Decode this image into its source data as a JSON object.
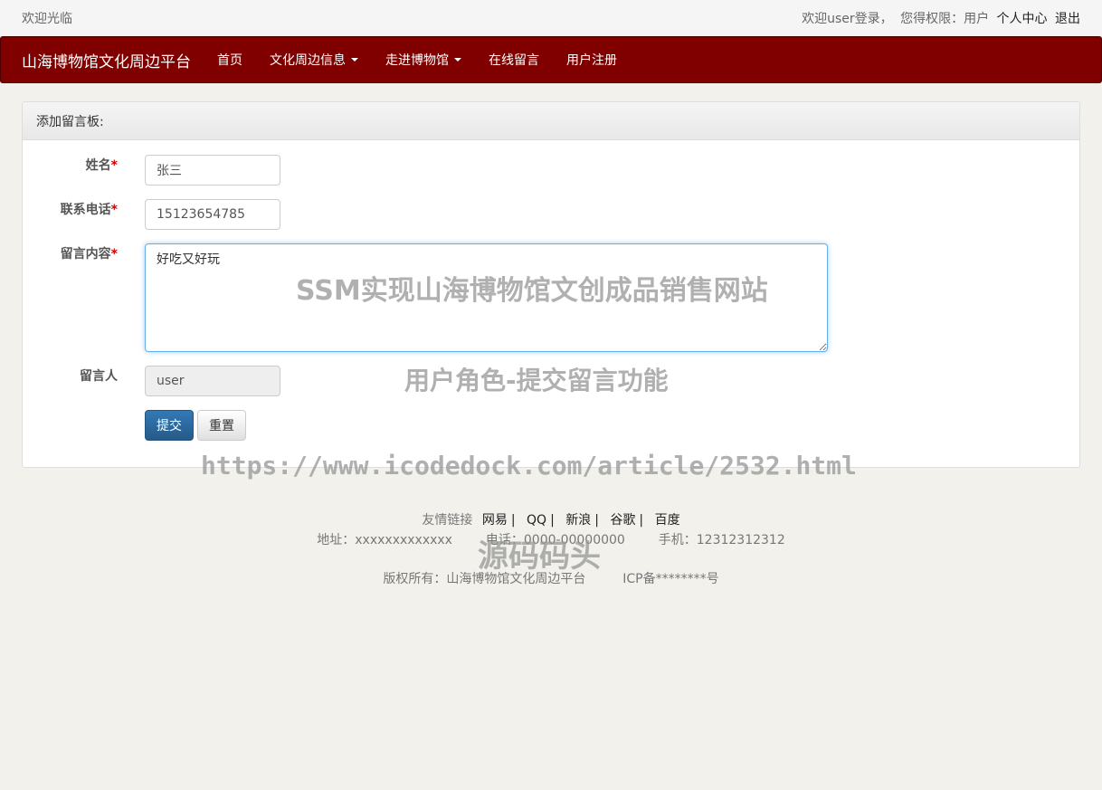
{
  "topbar": {
    "welcome": "欢迎光临",
    "user_greeting": "欢迎user登录，",
    "permission_label": "您得权限：用户",
    "profile_link": "个人中心",
    "logout_link": "退出"
  },
  "navbar": {
    "brand": "山海博物馆文化周边平台",
    "items": [
      {
        "label": "首页",
        "dropdown": false
      },
      {
        "label": "文化周边信息",
        "dropdown": true
      },
      {
        "label": "走进博物馆",
        "dropdown": true
      },
      {
        "label": "在线留言",
        "dropdown": false
      },
      {
        "label": "用户注册",
        "dropdown": false
      }
    ],
    "bg_color": "#800000"
  },
  "panel": {
    "heading": "添加留言板:",
    "fields": {
      "name": {
        "label": "姓名",
        "value": "张三",
        "required": true
      },
      "phone": {
        "label": "联系电话",
        "value": "15123654785",
        "required": true
      },
      "content": {
        "label": "留言内容",
        "value": "好吃又好玩",
        "required": true
      },
      "author": {
        "label": "留言人",
        "value": "user",
        "disabled": true
      }
    },
    "submit_label": "提交",
    "reset_label": "重置"
  },
  "footer": {
    "links_label": "友情链接",
    "links": [
      "网易",
      "QQ",
      "新浪",
      "谷歌",
      "百度"
    ],
    "address": "地址：xxxxxxxxxxxxx",
    "phone": "电话：0000-00000000",
    "mobile": "手机：12312312312",
    "copyright": "版权所有：山海博物馆文化周边平台",
    "icp": "ICP备********号"
  },
  "watermarks": {
    "title": "SSM实现山海博物馆文创成品销售网站",
    "subtitle": "用户角色-提交留言功能",
    "url": "https://www.icodedock.com/article/2532.html",
    "brand": "源码码头"
  }
}
